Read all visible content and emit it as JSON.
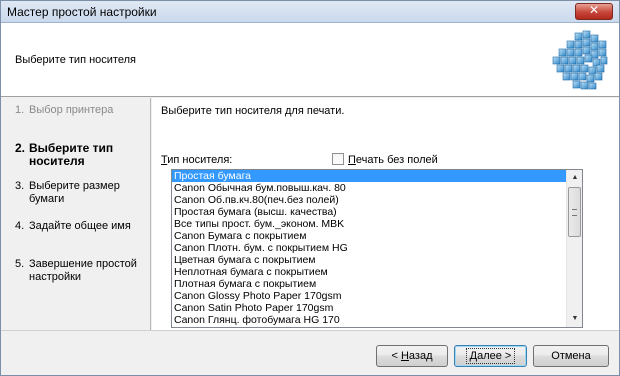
{
  "window": {
    "title": "Мастер простой настройки",
    "close_glyph": "✕"
  },
  "header": {
    "subtitle": "Выберите тип носителя",
    "logo_icon": "printer-grid-logo-icon"
  },
  "sidebar": {
    "steps": [
      {
        "num": "1.",
        "label": "Выбор принтера",
        "state": "done"
      },
      {
        "num": "2.",
        "label": "Выберите тип носителя",
        "state": "current"
      },
      {
        "num": "3.",
        "label": "Выберите размер бумаги",
        "state": "pending"
      },
      {
        "num": "4.",
        "label": "Задайте общее имя",
        "state": "pending"
      },
      {
        "num": "5.",
        "label": "Завершение простой настройки",
        "state": "pending"
      }
    ]
  },
  "main": {
    "prompt": "Выберите тип носителя для печати.",
    "media_label_mnemonic": "Т",
    "media_label_rest": "ип носителя:",
    "borderless_mnemonic": "П",
    "borderless_rest": "ечать без полей",
    "borderless_checked": false,
    "media_types": [
      "Простая бумага",
      "Canon Обычная бум.повыш.кач. 80",
      "Canon Об.пв.кч.80(печ.без полей)",
      "Простая бумага (высш. качества)",
      "Все типы прост. бум._эконом. MBK",
      "Canon Бумага с покрытием",
      "Canon Плотн. бум. с покрытием HG",
      "Цветная бумага с покрытием",
      "Неплотная бумага с покрытием",
      "Плотная бумага с покрытием",
      "Canon Glossy Photo Paper 170gsm",
      "Canon Satin Photo Paper 170gsm",
      "Canon Глянц. фотобумага HG 170"
    ],
    "selected_index": 0
  },
  "footer": {
    "back_prefix": "< ",
    "back_mnemonic": "Н",
    "back_rest": "азад",
    "next_mnemonic": "Д",
    "next_rest": "алее >",
    "cancel_label": "Отмена"
  }
}
